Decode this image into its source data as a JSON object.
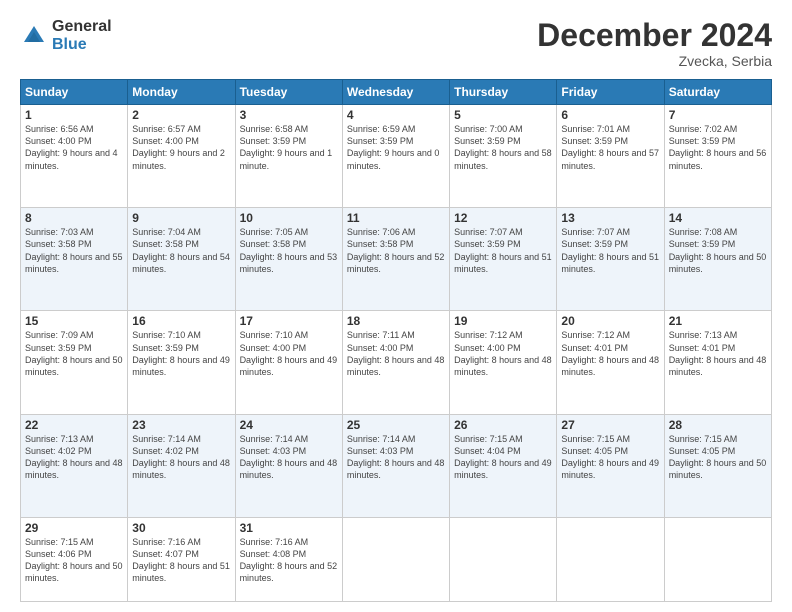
{
  "header": {
    "logo": {
      "general": "General",
      "blue": "Blue"
    },
    "title": "December 2024",
    "subtitle": "Zvecka, Serbia"
  },
  "days_of_week": [
    "Sunday",
    "Monday",
    "Tuesday",
    "Wednesday",
    "Thursday",
    "Friday",
    "Saturday"
  ],
  "weeks": [
    [
      {
        "day": "1",
        "info": "Sunrise: 6:56 AM\nSunset: 4:00 PM\nDaylight: 9 hours\nand 4 minutes."
      },
      {
        "day": "2",
        "info": "Sunrise: 6:57 AM\nSunset: 4:00 PM\nDaylight: 9 hours\nand 2 minutes."
      },
      {
        "day": "3",
        "info": "Sunrise: 6:58 AM\nSunset: 3:59 PM\nDaylight: 9 hours\nand 1 minute."
      },
      {
        "day": "4",
        "info": "Sunrise: 6:59 AM\nSunset: 3:59 PM\nDaylight: 9 hours\nand 0 minutes."
      },
      {
        "day": "5",
        "info": "Sunrise: 7:00 AM\nSunset: 3:59 PM\nDaylight: 8 hours\nand 58 minutes."
      },
      {
        "day": "6",
        "info": "Sunrise: 7:01 AM\nSunset: 3:59 PM\nDaylight: 8 hours\nand 57 minutes."
      },
      {
        "day": "7",
        "info": "Sunrise: 7:02 AM\nSunset: 3:59 PM\nDaylight: 8 hours\nand 56 minutes."
      }
    ],
    [
      {
        "day": "8",
        "info": "Sunrise: 7:03 AM\nSunset: 3:58 PM\nDaylight: 8 hours\nand 55 minutes."
      },
      {
        "day": "9",
        "info": "Sunrise: 7:04 AM\nSunset: 3:58 PM\nDaylight: 8 hours\nand 54 minutes."
      },
      {
        "day": "10",
        "info": "Sunrise: 7:05 AM\nSunset: 3:58 PM\nDaylight: 8 hours\nand 53 minutes."
      },
      {
        "day": "11",
        "info": "Sunrise: 7:06 AM\nSunset: 3:58 PM\nDaylight: 8 hours\nand 52 minutes."
      },
      {
        "day": "12",
        "info": "Sunrise: 7:07 AM\nSunset: 3:59 PM\nDaylight: 8 hours\nand 51 minutes."
      },
      {
        "day": "13",
        "info": "Sunrise: 7:07 AM\nSunset: 3:59 PM\nDaylight: 8 hours\nand 51 minutes."
      },
      {
        "day": "14",
        "info": "Sunrise: 7:08 AM\nSunset: 3:59 PM\nDaylight: 8 hours\nand 50 minutes."
      }
    ],
    [
      {
        "day": "15",
        "info": "Sunrise: 7:09 AM\nSunset: 3:59 PM\nDaylight: 8 hours\nand 50 minutes."
      },
      {
        "day": "16",
        "info": "Sunrise: 7:10 AM\nSunset: 3:59 PM\nDaylight: 8 hours\nand 49 minutes."
      },
      {
        "day": "17",
        "info": "Sunrise: 7:10 AM\nSunset: 4:00 PM\nDaylight: 8 hours\nand 49 minutes."
      },
      {
        "day": "18",
        "info": "Sunrise: 7:11 AM\nSunset: 4:00 PM\nDaylight: 8 hours\nand 48 minutes."
      },
      {
        "day": "19",
        "info": "Sunrise: 7:12 AM\nSunset: 4:00 PM\nDaylight: 8 hours\nand 48 minutes."
      },
      {
        "day": "20",
        "info": "Sunrise: 7:12 AM\nSunset: 4:01 PM\nDaylight: 8 hours\nand 48 minutes."
      },
      {
        "day": "21",
        "info": "Sunrise: 7:13 AM\nSunset: 4:01 PM\nDaylight: 8 hours\nand 48 minutes."
      }
    ],
    [
      {
        "day": "22",
        "info": "Sunrise: 7:13 AM\nSunset: 4:02 PM\nDaylight: 8 hours\nand 48 minutes."
      },
      {
        "day": "23",
        "info": "Sunrise: 7:14 AM\nSunset: 4:02 PM\nDaylight: 8 hours\nand 48 minutes."
      },
      {
        "day": "24",
        "info": "Sunrise: 7:14 AM\nSunset: 4:03 PM\nDaylight: 8 hours\nand 48 minutes."
      },
      {
        "day": "25",
        "info": "Sunrise: 7:14 AM\nSunset: 4:03 PM\nDaylight: 8 hours\nand 48 minutes."
      },
      {
        "day": "26",
        "info": "Sunrise: 7:15 AM\nSunset: 4:04 PM\nDaylight: 8 hours\nand 49 minutes."
      },
      {
        "day": "27",
        "info": "Sunrise: 7:15 AM\nSunset: 4:05 PM\nDaylight: 8 hours\nand 49 minutes."
      },
      {
        "day": "28",
        "info": "Sunrise: 7:15 AM\nSunset: 4:05 PM\nDaylight: 8 hours\nand 50 minutes."
      }
    ],
    [
      {
        "day": "29",
        "info": "Sunrise: 7:15 AM\nSunset: 4:06 PM\nDaylight: 8 hours\nand 50 minutes."
      },
      {
        "day": "30",
        "info": "Sunrise: 7:16 AM\nSunset: 4:07 PM\nDaylight: 8 hours\nand 51 minutes."
      },
      {
        "day": "31",
        "info": "Sunrise: 7:16 AM\nSunset: 4:08 PM\nDaylight: 8 hours\nand 52 minutes."
      },
      null,
      null,
      null,
      null
    ]
  ]
}
